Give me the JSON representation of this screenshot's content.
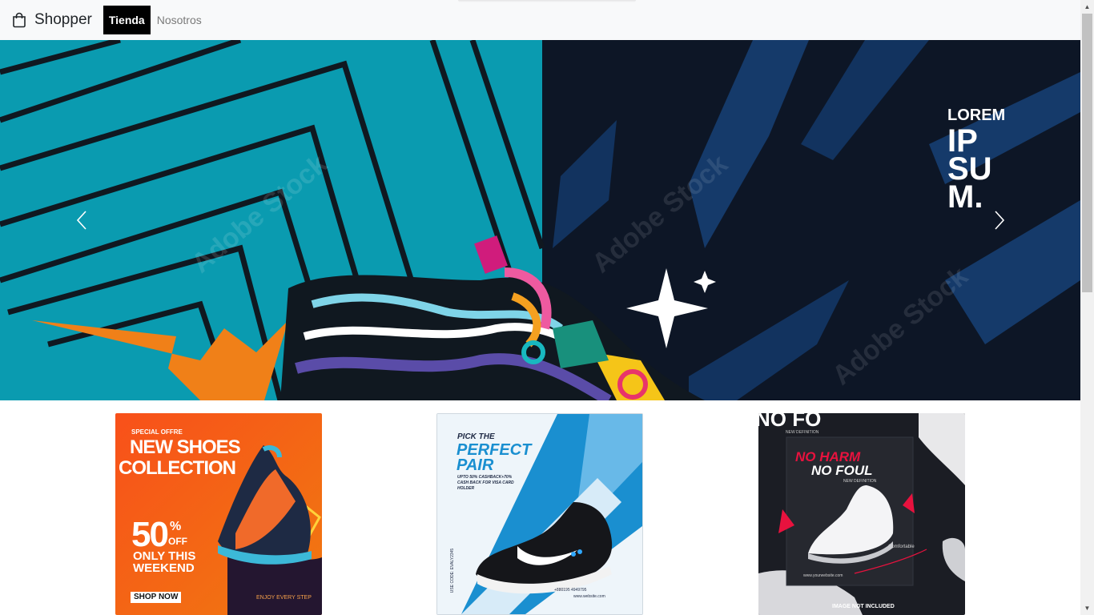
{
  "navbar": {
    "brand": "Shopper",
    "brand_icon": "shopping-bag-icon",
    "links": [
      {
        "label": "Tienda",
        "active": true
      },
      {
        "label": "Nosotros",
        "active": false
      }
    ]
  },
  "carousel": {
    "slide_text_lines": [
      "LOREM",
      "IP",
      "SU",
      "M."
    ],
    "watermark": "Adobe Stock",
    "prev_icon": "chevron-left-icon",
    "next_icon": "chevron-right-icon"
  },
  "cards": [
    {
      "kicker": "SPECIAL OFFRE",
      "title_line1": "NEW SHOES",
      "title_line2": "COLLECTION",
      "discount": "50",
      "percent": "%",
      "off": "OFF",
      "promo_line1": "ONLY THIS",
      "promo_line2": "WEEKEND",
      "cta": "SHOP NOW",
      "tagline": "ENJOY EVERY STEP"
    },
    {
      "kicker": "PICK THE",
      "title_line1": "PERFECT",
      "title_line2": "PAIR",
      "offer_line1": "UPTO 50% CASHBACK+70%",
      "offer_line2": "CASH BACK FOR VISA CARD",
      "offer_line3": "HOLDER",
      "code": "USE CODE: EVALY2345",
      "phone": "+880195 4949795",
      "website": "www.website.com"
    },
    {
      "top_text": "NO FO",
      "top_sub": "NEW DEFINITION",
      "title_line1": "NO HARM",
      "title_line2": "NO FOUL",
      "subtitle": "NEW DEFINITION",
      "label": "Comfortable",
      "website": "www.yourwebsite.com",
      "footer": "IMAGE NOT INCLUDED"
    }
  ],
  "colors": {
    "navbar_bg": "#f8f9fa",
    "active_tab_bg": "#000000",
    "banner_teal": "#0a9bb0",
    "banner_navy": "#0d1626",
    "card1_orange": "#f05a14",
    "card2_blue": "#1a8fd0",
    "card3_dark": "#1b1d24"
  }
}
